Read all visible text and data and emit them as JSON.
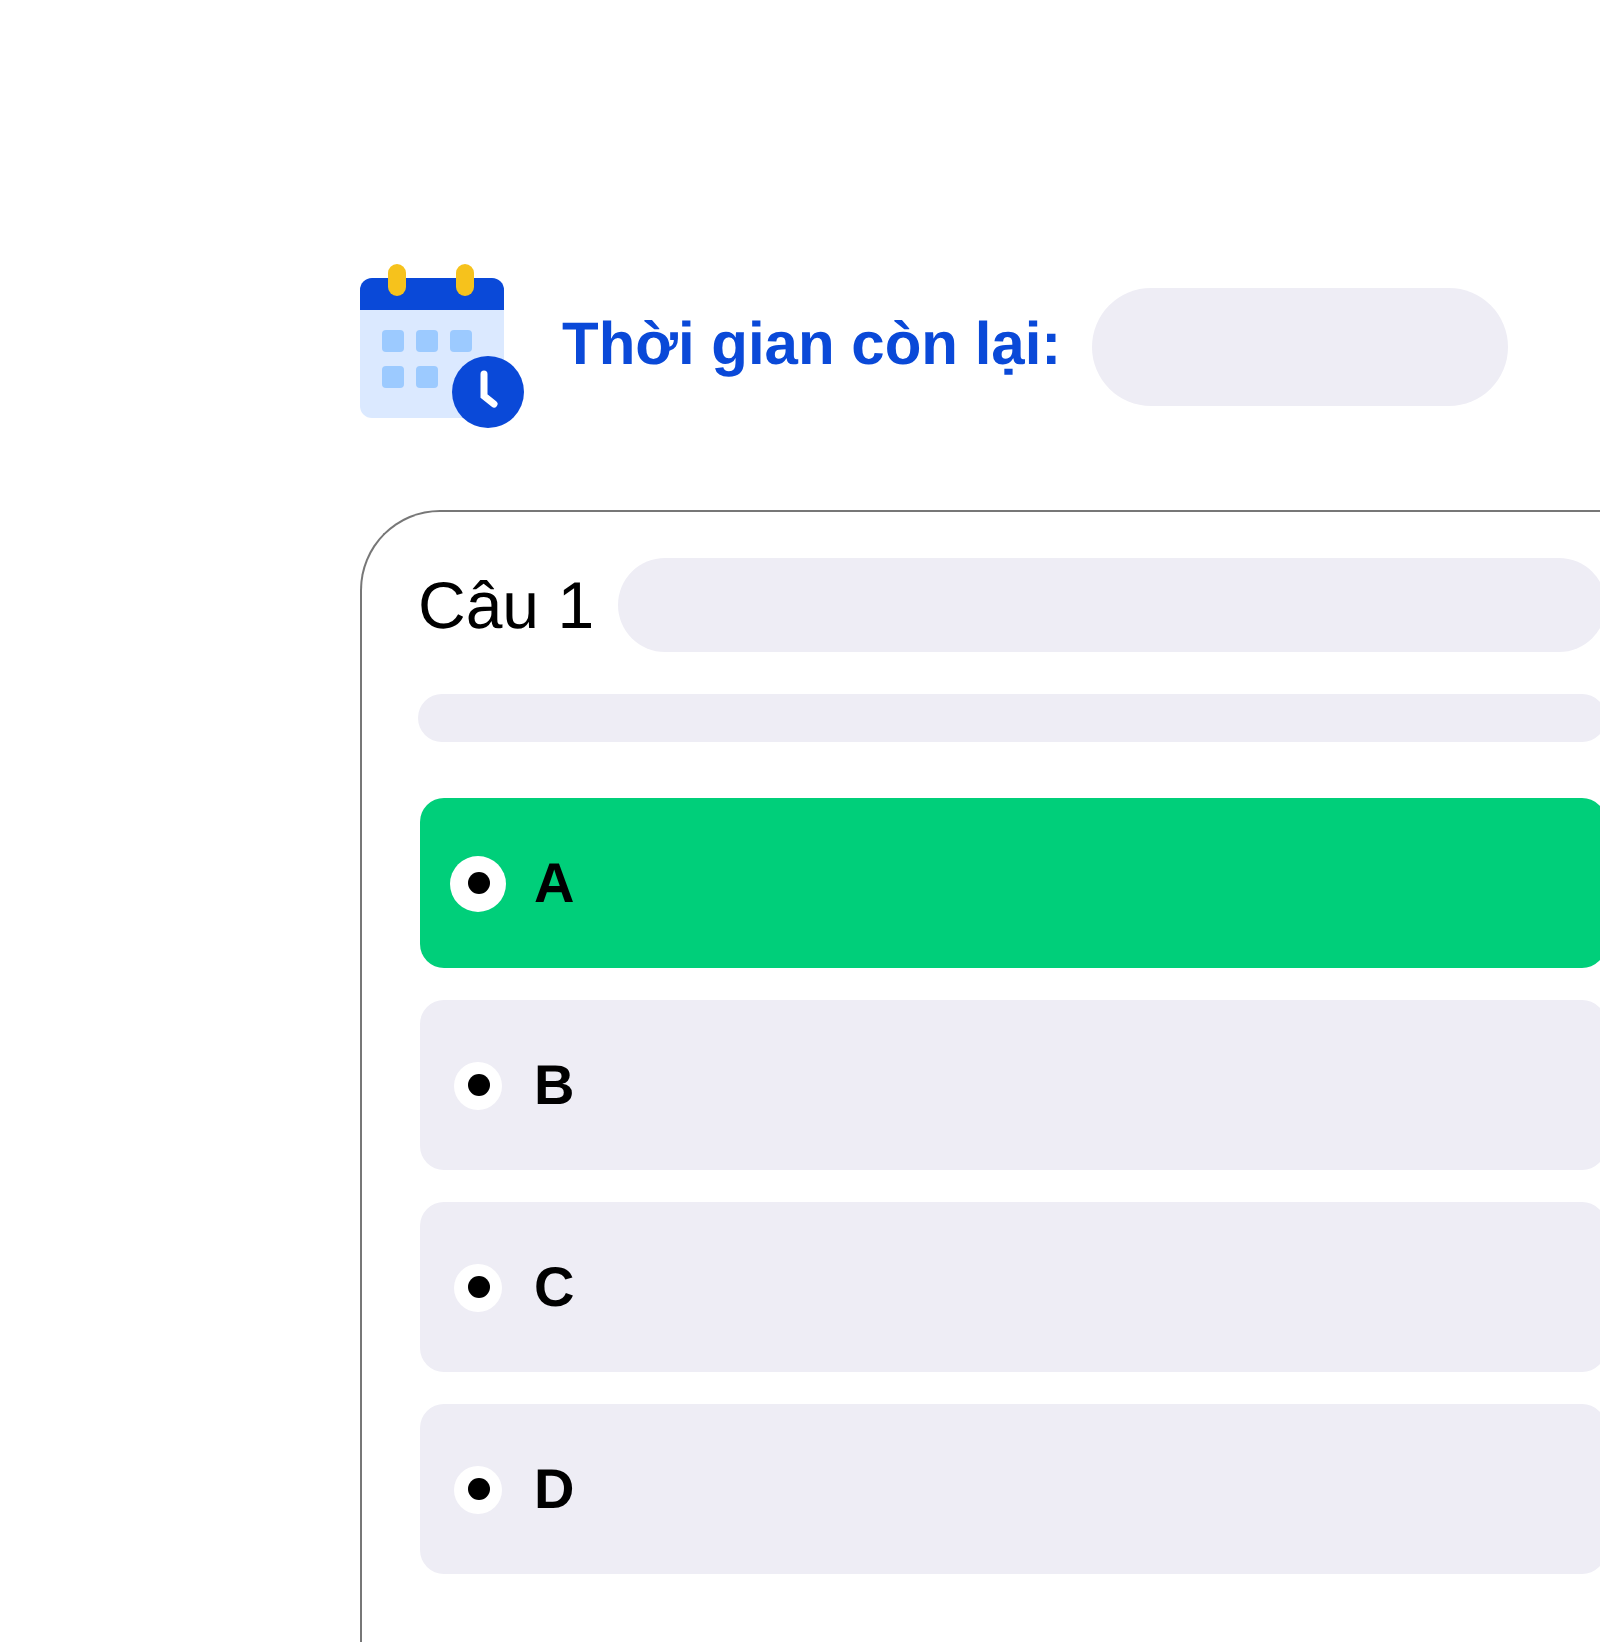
{
  "timer": {
    "label": "Thời gian còn lại:"
  },
  "question": {
    "title": "Câu 1"
  },
  "options": [
    {
      "label": "A",
      "selected": true
    },
    {
      "label": "B",
      "selected": false
    },
    {
      "label": "C",
      "selected": false
    },
    {
      "label": "D",
      "selected": false
    }
  ]
}
